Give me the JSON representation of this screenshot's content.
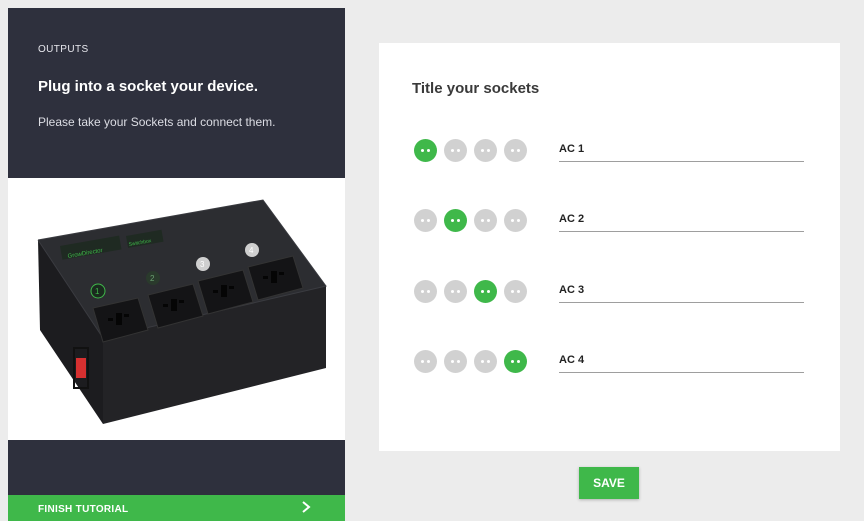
{
  "panel": {
    "section_label": "OUTPUTS",
    "title": "Plug into a socket your device.",
    "description": "Please take your Sockets and connect them.",
    "finish_label": "FINISH TUTORIAL"
  },
  "device_image": {
    "brand_text": "GrowDirector",
    "model_text": "Switchbox",
    "socket_numbers": [
      "1",
      "2",
      "3",
      "4"
    ]
  },
  "sockets_card": {
    "title": "Title your sockets",
    "rows": [
      {
        "value": "AC 1",
        "active_index": 0
      },
      {
        "value": "AC 2",
        "active_index": 1
      },
      {
        "value": "AC 3",
        "active_index": 2
      },
      {
        "value": "AC 4",
        "active_index": 3
      }
    ]
  },
  "save_label": "SAVE",
  "colors": {
    "panel_bg": "#2e303d",
    "accent_green": "#3fb84a",
    "dot_inactive": "#d1d1d1",
    "page_bg": "#ececec"
  },
  "icons": {
    "finish_chevron": "chevron-right-icon",
    "socket_dot": "socket-indicator-icon"
  }
}
